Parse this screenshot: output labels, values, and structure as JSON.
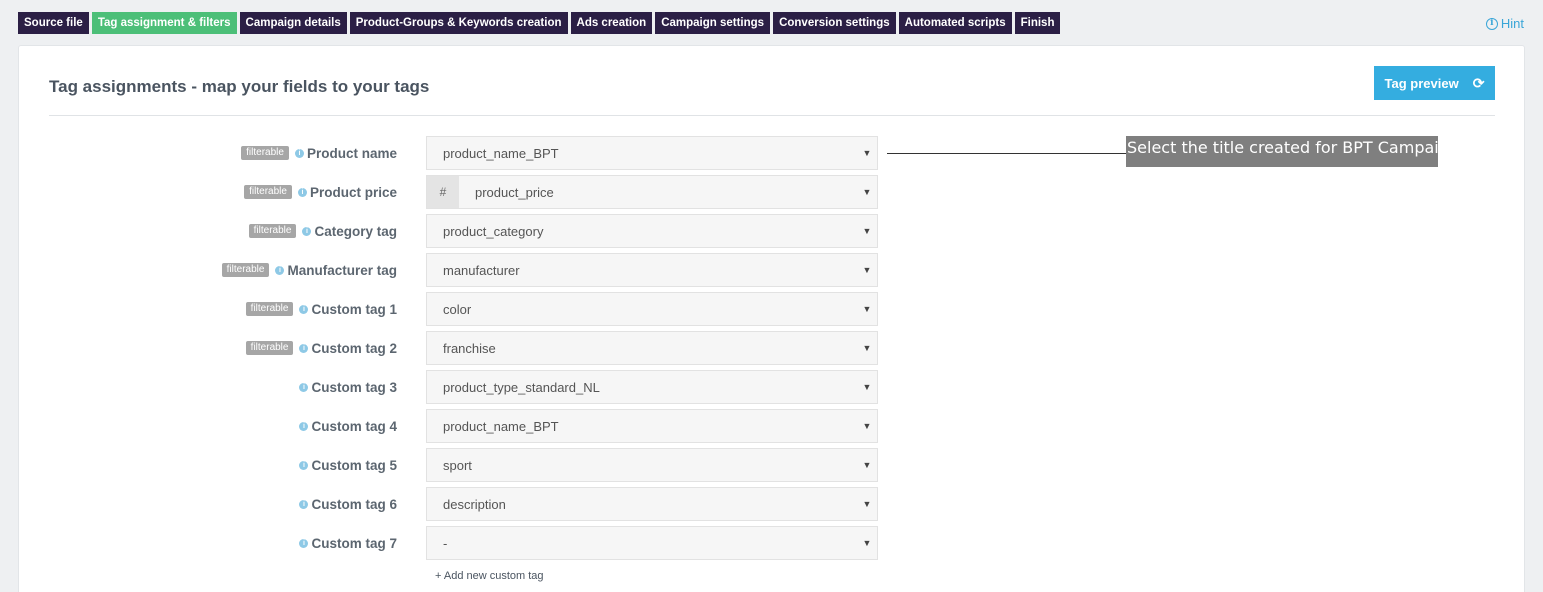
{
  "nav": {
    "tabs": [
      {
        "label": "Source file",
        "active": false
      },
      {
        "label": "Tag assignment & filters",
        "active": true
      },
      {
        "label": "Campaign details",
        "active": false
      },
      {
        "label": "Product-Groups & Keywords creation",
        "active": false
      },
      {
        "label": "Ads creation",
        "active": false
      },
      {
        "label": "Campaign settings",
        "active": false
      },
      {
        "label": "Conversion settings",
        "active": false
      },
      {
        "label": "Automated scripts",
        "active": false
      },
      {
        "label": "Finish",
        "active": false
      }
    ],
    "hint_label": "Hint"
  },
  "panel": {
    "title": "Tag assignments - map your fields to your tags",
    "tag_preview_label": "Tag preview",
    "badge_label": "filterable",
    "rows": [
      {
        "label": "Product name",
        "filterable": true,
        "value": "product_name_BPT",
        "prefix": ""
      },
      {
        "label": "Product price",
        "filterable": true,
        "value": "product_price",
        "prefix": "#"
      },
      {
        "label": "Category tag",
        "filterable": true,
        "value": "product_category",
        "prefix": ""
      },
      {
        "label": "Manufacturer tag",
        "filterable": true,
        "value": "manufacturer",
        "prefix": ""
      },
      {
        "label": "Custom tag 1",
        "filterable": true,
        "value": "color",
        "prefix": ""
      },
      {
        "label": "Custom tag 2",
        "filterable": true,
        "value": "franchise",
        "prefix": ""
      },
      {
        "label": "Custom tag 3",
        "filterable": false,
        "value": "product_type_standard_NL",
        "prefix": ""
      },
      {
        "label": "Custom tag 4",
        "filterable": false,
        "value": "product_name_BPT",
        "prefix": ""
      },
      {
        "label": "Custom tag 5",
        "filterable": false,
        "value": "sport",
        "prefix": ""
      },
      {
        "label": "Custom tag 6",
        "filterable": false,
        "value": "description",
        "prefix": ""
      },
      {
        "label": "Custom tag 7",
        "filterable": false,
        "value": "-",
        "prefix": ""
      }
    ],
    "add_custom_tag_label": "+ Add new custom tag"
  },
  "annotation": {
    "text": "Select the title created for BPT Campaign"
  },
  "colors": {
    "tab_bg": "#2b1f45",
    "tab_active_bg": "#4cbf78",
    "accent_blue": "#34ade0",
    "annotation_bg": "#7f7f7f"
  }
}
